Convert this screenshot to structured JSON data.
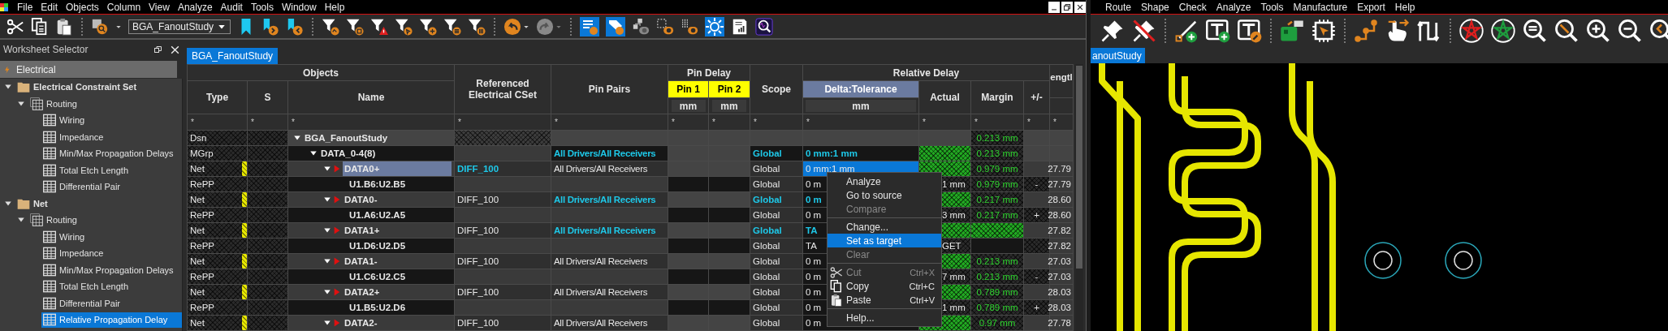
{
  "erc_window": {
    "menu": [
      "File",
      "Edit",
      "Objects",
      "Column",
      "View",
      "Analyze",
      "Audit",
      "Tools",
      "Window",
      "Help"
    ],
    "toolbar": {
      "design_selector": "BGA_FanoutStudy"
    },
    "worksheet_selector": {
      "title": "Worksheet Selector",
      "domain": "Electrical",
      "tree": [
        {
          "label": "Electrical Constraint Set",
          "expanded": true,
          "selected": false,
          "children": [
            {
              "label": "Routing",
              "expanded": true,
              "selected": false,
              "children": [
                {
                  "label": "Wiring",
                  "selected": false
                },
                {
                  "label": "Impedance",
                  "selected": false
                },
                {
                  "label": "Min/Max Propagation Delays",
                  "selected": false
                },
                {
                  "label": "Total Etch Length",
                  "selected": false
                },
                {
                  "label": "Differential Pair",
                  "selected": false
                }
              ]
            }
          ]
        },
        {
          "label": "Net",
          "expanded": true,
          "selected": false,
          "children": [
            {
              "label": "Routing",
              "expanded": true,
              "selected": false,
              "children": [
                {
                  "label": "Wiring",
                  "selected": false
                },
                {
                  "label": "Impedance",
                  "selected": false
                },
                {
                  "label": "Min/Max Propagation Delays",
                  "selected": false
                },
                {
                  "label": "Total Etch Length",
                  "selected": false
                },
                {
                  "label": "Differential Pair",
                  "selected": false
                },
                {
                  "label": "Relative Propagation Delay",
                  "selected": true
                }
              ]
            }
          ]
        }
      ]
    },
    "tabs": [
      {
        "label": "BGA_FanoutStudy",
        "selected": true
      }
    ],
    "table": {
      "header": {
        "objects": "Objects",
        "type": "Type",
        "s": "S",
        "name": "Name",
        "cset": "Referenced Electrical CSet",
        "pin_pairs": "Pin Pairs",
        "pin_delay": "Pin Delay",
        "pins": [
          {
            "label": "Pin 1",
            "unit": "mm",
            "highlighted": true
          },
          {
            "label": "Pin 2",
            "unit": "mm",
            "highlighted": true
          }
        ],
        "scope": "Scope",
        "relative_delay": "Relative Delay",
        "delta_tolerance": {
          "label": "Delta:Tolerance",
          "unit": "mm",
          "selected": true
        },
        "actual": "Actual",
        "margin": "Margin",
        "plus_minus": "+/-",
        "length": "engtl"
      },
      "filters": [
        "*",
        "*",
        "*",
        "*",
        "*",
        "*",
        "*",
        "*",
        "*",
        "*",
        "*",
        "*",
        "*"
      ],
      "rows": [
        {
          "kind": "design",
          "type": "Dsn",
          "name": "BGA_FanoutStudy",
          "expanded": true,
          "selected": false,
          "actual_pass": false,
          "margin": "0.213 mm",
          "margin_highlight": false
        },
        {
          "kind": "group",
          "type": "MGrp",
          "name": "DATA_0-4(8)",
          "expanded": true,
          "selected": false,
          "pin_pairs": "All Drivers/All Receivers",
          "overridden": true,
          "scope": "Global",
          "delta": "0 mm:1 mm",
          "actual_pass": true,
          "margin": "0.213 mm",
          "margin_highlight": false
        },
        {
          "kind": "net",
          "type": "Net",
          "name": "DATA0+",
          "expanded": true,
          "selected": true,
          "cset": "DIFF_100",
          "cset_overridden": true,
          "pin_pairs": "All Drivers/All Receivers",
          "overridden": false,
          "scope": "Global",
          "delta": "0 mm:1 mm",
          "actual_pass": true,
          "margin": "0.979 mm",
          "margin_highlight": false,
          "length": "27.79"
        },
        {
          "kind": "pin_pair",
          "type": "RePP",
          "name": "U1.B6:U2.B5",
          "selected": false,
          "overridden": false,
          "scope": "Global",
          "delta": "0 m",
          "actual": "1 mm",
          "actual_pass": false,
          "margin": "0.979 mm",
          "margin_highlight": false,
          "plus_minus": "-",
          "length": "27.79"
        },
        {
          "kind": "net",
          "type": "Net",
          "name": "DATA0-",
          "expanded": true,
          "selected": false,
          "cset": "DIFF_100",
          "cset_overridden": false,
          "pin_pairs": "All Drivers/All Receivers",
          "overridden": true,
          "scope": "Global",
          "delta": "0 m",
          "actual_pass": true,
          "margin": "0.217 mm",
          "margin_highlight": false,
          "length": "28.60"
        },
        {
          "kind": "pin_pair",
          "type": "RePP",
          "name": "U1.A6:U2.A5",
          "selected": false,
          "overridden": false,
          "scope": "Global",
          "delta": "0 m",
          "actual": "3 mm",
          "actual_pass": false,
          "margin": "0.217 mm",
          "margin_highlight": false,
          "plus_minus": "+",
          "length": "28.60"
        },
        {
          "kind": "net",
          "type": "Net",
          "name": "DATA1+",
          "expanded": true,
          "selected": false,
          "cset": "DIFF_100",
          "cset_overridden": false,
          "pin_pairs": "All Drivers/All Receivers",
          "overridden": true,
          "scope": "Global",
          "delta": "TA",
          "actual_pass": true,
          "margin_highlight": true,
          "length": "27.82"
        },
        {
          "kind": "pin_pair",
          "type": "RePP",
          "name": "U1.D6:U2.D5",
          "selected": false,
          "overridden": false,
          "scope": "Global",
          "delta": "TA",
          "actual": "GET",
          "actual_pass": false,
          "margin_highlight": false,
          "length": "27.82"
        },
        {
          "kind": "net",
          "type": "Net",
          "name": "DATA1-",
          "expanded": true,
          "selected": false,
          "cset": "DIFF_100",
          "cset_overridden": false,
          "pin_pairs": "All Drivers/All Receivers",
          "overridden": false,
          "scope": "Global",
          "delta": "0 m",
          "actual_pass": true,
          "margin": "0.213 mm",
          "margin_highlight": false,
          "length": "27.03"
        },
        {
          "kind": "pin_pair",
          "type": "RePP",
          "name": "U1.C6:U2.C5",
          "selected": false,
          "overridden": false,
          "scope": "Global",
          "delta": "0 m",
          "actual": "7 mm",
          "actual_pass": false,
          "margin": "0.213 mm",
          "margin_highlight": false,
          "plus_minus": "-",
          "length": "27.03"
        },
        {
          "kind": "net",
          "type": "Net",
          "name": "DATA2+",
          "expanded": true,
          "selected": false,
          "cset": "DIFF_100",
          "cset_overridden": false,
          "pin_pairs": "All Drivers/All Receivers",
          "overridden": false,
          "scope": "Global",
          "delta": "0 m",
          "actual_pass": true,
          "margin": "0.789 mm",
          "margin_highlight": false,
          "length": "28.03"
        },
        {
          "kind": "pin_pair",
          "type": "RePP",
          "name": "U1.B5:U2.D6",
          "selected": false,
          "overridden": false,
          "scope": "Global",
          "delta": "0 m",
          "actual": "1 mm",
          "actual_pass": false,
          "margin": "0.789 mm",
          "margin_highlight": false,
          "plus_minus": "+",
          "length": "28.03"
        },
        {
          "kind": "net",
          "type": "Net",
          "name": "DATA2-",
          "expanded": true,
          "selected": false,
          "cset": "DIFF_100",
          "cset_overridden": false,
          "pin_pairs": "All Drivers/All Receivers",
          "overridden": false,
          "scope": "Global",
          "delta": "0 m",
          "actual_pass": true,
          "margin": "0.97 mm",
          "margin_highlight": false,
          "length": "27.78"
        }
      ]
    },
    "context_menu": [
      {
        "kind": "command",
        "label": "Analyze",
        "disabled": false,
        "selected": false
      },
      {
        "kind": "command",
        "label": "Go to source",
        "disabled": false,
        "selected": false
      },
      {
        "kind": "command",
        "label": "Compare",
        "disabled": true,
        "selected": false
      },
      {
        "kind": "separator"
      },
      {
        "kind": "command",
        "label": "Change...",
        "disabled": false,
        "selected": false
      },
      {
        "kind": "command",
        "label": "Set as target",
        "disabled": false,
        "selected": true
      },
      {
        "kind": "command",
        "label": "Clear",
        "disabled": true,
        "selected": false
      },
      {
        "kind": "separator"
      },
      {
        "kind": "cut",
        "label": "Cut",
        "shortcut": "Ctrl+X",
        "disabled": true,
        "selected": false
      },
      {
        "kind": "copy",
        "label": "Copy",
        "shortcut": "Ctrl+C",
        "disabled": false,
        "selected": false
      },
      {
        "kind": "paste",
        "label": "Paste",
        "shortcut": "Ctrl+V",
        "disabled": false,
        "selected": false
      },
      {
        "kind": "separator"
      },
      {
        "kind": "command",
        "label": "Help...",
        "disabled": false,
        "selected": false
      }
    ]
  },
  "layout_window": {
    "menu": [
      "Route",
      "Shape",
      "Check",
      "Analyze",
      "Tools",
      "Manufacture",
      "Export",
      "Help"
    ],
    "tabs": [
      {
        "label": "anoutStudy",
        "selected": true
      }
    ]
  }
}
